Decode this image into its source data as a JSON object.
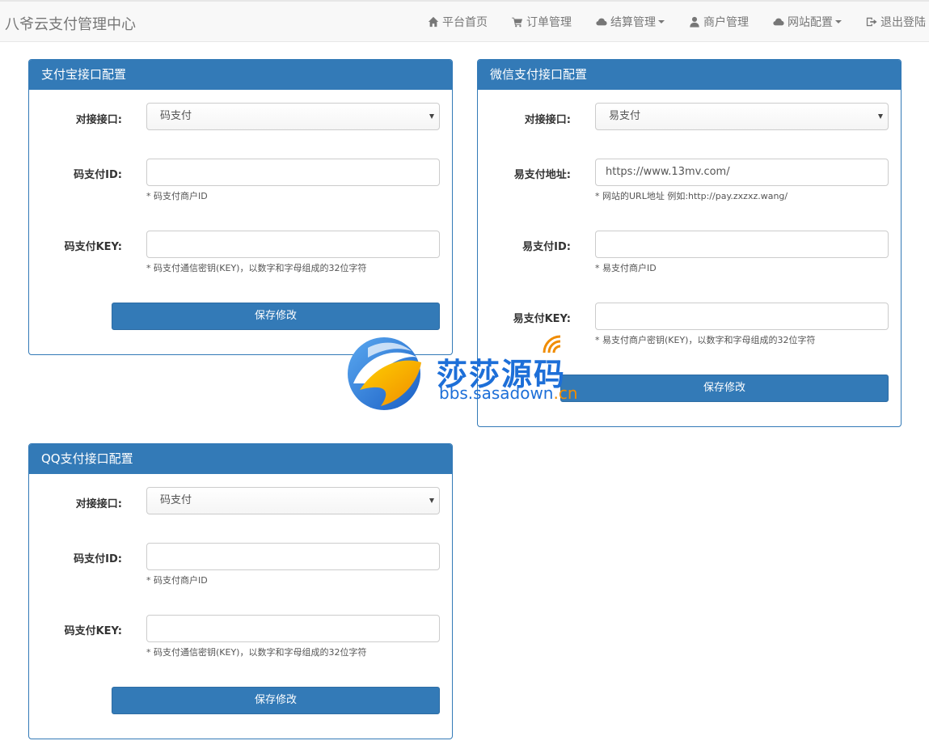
{
  "header": {
    "brand": "八爷云支付管理中心",
    "nav": [
      {
        "icon": "home-icon",
        "label": "平台首页",
        "dropdown": false
      },
      {
        "icon": "cart-icon",
        "label": "订单管理",
        "dropdown": false
      },
      {
        "icon": "cloud-icon",
        "label": "结算管理",
        "dropdown": true
      },
      {
        "icon": "user-icon",
        "label": "商户管理",
        "dropdown": false
      },
      {
        "icon": "cloud-icon",
        "label": "网站配置",
        "dropdown": true
      },
      {
        "icon": "logout-icon",
        "label": "退出登陆",
        "dropdown": false
      }
    ]
  },
  "alipay": {
    "title": "支付宝接口配置",
    "interface_label": "对接接口:",
    "interface_value": "码支付",
    "id_label": "码支付ID:",
    "id_value": "",
    "id_hint": "* 码支付商户ID",
    "key_label": "码支付KEY:",
    "key_value": "",
    "key_hint": "* 码支付通信密钥(KEY)，以数字和字母组成的32位字符",
    "save_label": "保存修改"
  },
  "wechat": {
    "title": "微信支付接口配置",
    "interface_label": "对接接口:",
    "interface_value": "易支付",
    "url_label": "易支付地址:",
    "url_value": "https://www.13mv.com/",
    "url_hint": "* 网站的URL地址 例如:http://pay.zxzxz.wang/",
    "id_label": "易支付ID:",
    "id_value": "",
    "id_hint": "* 易支付商户ID",
    "key_label": "易支付KEY:",
    "key_value": "",
    "key_hint": "* 易支付商户密钥(KEY)，以数字和字母组成的32位字符",
    "save_label": "保存修改"
  },
  "qq": {
    "title": "QQ支付接口配置",
    "interface_label": "对接接口:",
    "interface_value": "码支付",
    "id_label": "码支付ID:",
    "id_value": "",
    "id_hint": "* 码支付商户ID",
    "key_label": "码支付KEY:",
    "key_value": "",
    "key_hint": "* 码支付通信密钥(KEY)，以数字和字母组成的32位字符",
    "save_label": "保存修改"
  },
  "watermark": {
    "title": "莎莎源码",
    "domain_main": "bbs.sasadown",
    "domain_suffix": ".cn"
  },
  "colors": {
    "primary": "#337ab7",
    "navbar_bg": "#f8f8f8",
    "watermark_blue": "#1d6fd8",
    "watermark_orange": "#f08c00"
  }
}
